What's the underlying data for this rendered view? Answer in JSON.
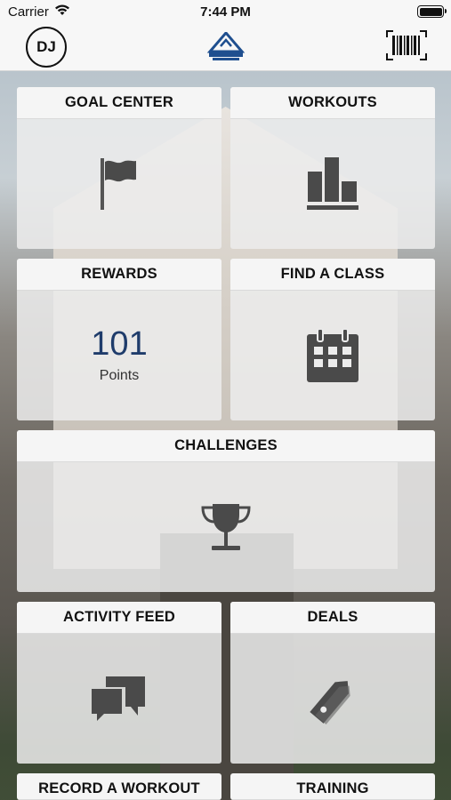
{
  "status_bar": {
    "carrier": "Carrier",
    "time": "7:44 PM"
  },
  "header": {
    "avatar_initials": "DJ",
    "logo_icon": "hampshire-hills-logo",
    "barcode_icon": "barcode-icon"
  },
  "tiles": {
    "goal_center": {
      "title": "GOAL CENTER",
      "icon": "flag-icon"
    },
    "workouts": {
      "title": "WORKOUTS",
      "icon": "bar-chart-icon"
    },
    "rewards": {
      "title": "REWARDS",
      "value": "101",
      "value_label": "Points"
    },
    "find_a_class": {
      "title": "FIND A CLASS",
      "icon": "calendar-icon"
    },
    "challenges": {
      "title": "CHALLENGES",
      "icon": "trophy-icon"
    },
    "activity_feed": {
      "title": "ACTIVITY FEED",
      "icon": "chat-bubbles-icon"
    },
    "deals": {
      "title": "DEALS",
      "icon": "tag-icon"
    },
    "record_a_workout": {
      "title": "RECORD A WORKOUT"
    },
    "training": {
      "title": "TRAINING"
    }
  },
  "colors": {
    "accent_blue": "#1f3c6b",
    "icon_gray": "#4a4a4a"
  }
}
